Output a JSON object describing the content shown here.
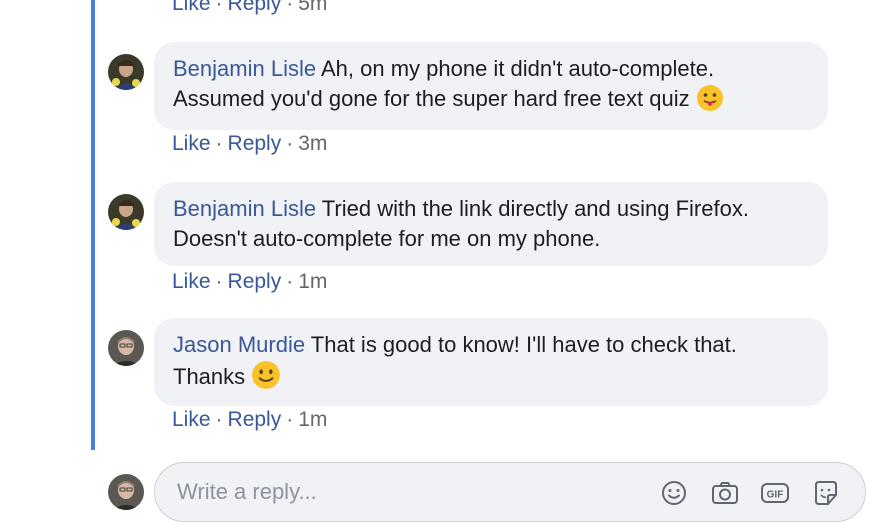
{
  "thread": {
    "top_meta": {
      "like": "Like",
      "reply": "Reply",
      "time": "5m"
    },
    "comments": [
      {
        "author": "Benjamin Lisle",
        "text_line1": "Ah, on my phone it didn't auto-complete.",
        "text_line2": "Assumed you'd gone for the super hard free text quiz",
        "emoji": "tongue-out-emoji",
        "like": "Like",
        "reply": "Reply",
        "time": "3m"
      },
      {
        "author": "Benjamin Lisle",
        "text_line1": "Tried with the link directly and using Firefox.",
        "text_line2": "Doesn't auto-complete for me on my phone.",
        "like": "Like",
        "reply": "Reply",
        "time": "1m"
      },
      {
        "author": "Jason Murdie",
        "text_line1": "That is good to know! I'll have to check that.",
        "text_line2": "Thanks",
        "emoji": "smile-emoji",
        "like": "Like",
        "reply": "Reply",
        "time": "1m"
      }
    ]
  },
  "reply_box": {
    "placeholder": "Write a reply...",
    "icons": [
      "emoji-icon",
      "camera-icon",
      "gif-icon",
      "sticker-icon"
    ]
  },
  "colors": {
    "link": "#385898",
    "thread_line": "#4a7fe0",
    "bubble": "#f0f2f5",
    "meta": "#65676b"
  }
}
